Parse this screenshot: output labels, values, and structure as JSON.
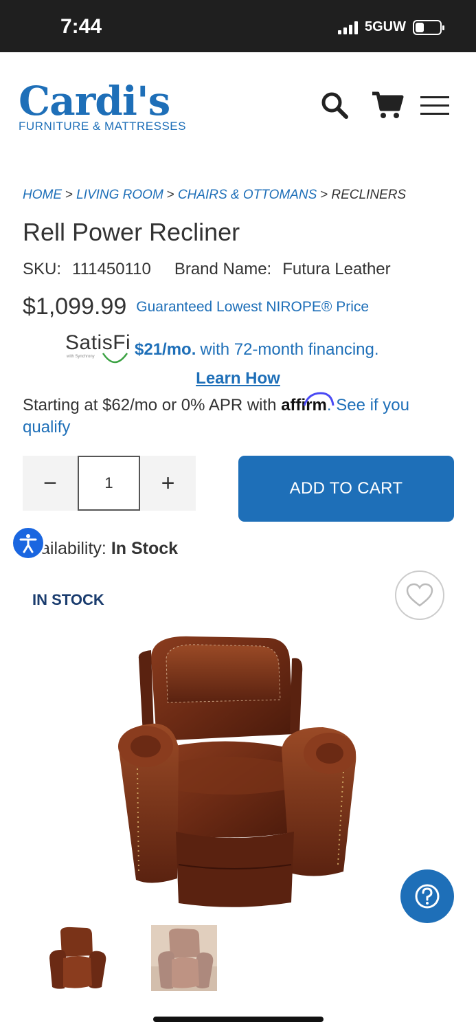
{
  "status_bar": {
    "time": "7:44",
    "network": "5GUW",
    "battery_level": 0.35,
    "icons": [
      "signal-icon",
      "battery-icon"
    ]
  },
  "header": {
    "logo_main": "Cardi's",
    "logo_sub": "FURNITURE & MATTRESSES",
    "icons": [
      "search-icon",
      "cart-icon",
      "menu-icon"
    ]
  },
  "breadcrumb": {
    "items": [
      "HOME",
      "LIVING ROOM",
      "CHAIRS & OTTOMANS",
      "RECLINERS"
    ],
    "separator": ">"
  },
  "product": {
    "title": "Rell Power Recliner",
    "sku_label": "SKU:",
    "sku": "111450110",
    "brand_label": "Brand Name:",
    "brand": "Futura Leather",
    "price": "$1,099.99",
    "price_note": "Guaranteed Lowest NIROPE® Price"
  },
  "financing": {
    "provider_logo": "SatisFi",
    "provider_sub": "with Synchrony",
    "monthly": "$21/mo.",
    "term_text": "with 72-month financing.",
    "learn_link": "Learn How",
    "affirm_prefix": "Starting at $62/mo or 0% APR with",
    "affirm_logo": "affirm",
    "affirm_link": ". See if you qualify"
  },
  "purchase": {
    "qty_minus": "−",
    "qty_value": "1",
    "qty_plus": "+",
    "add_to_cart": "ADD TO CART"
  },
  "availability": {
    "label": "ailability:",
    "value": "In Stock",
    "badge": "IN STOCK"
  },
  "gallery": {
    "main_image": "brown-leather-recliner",
    "thumbnails": [
      "recliner-front",
      "recliner-in-room"
    ]
  },
  "colors": {
    "brand_blue": "#1e6fb8",
    "accessibility_blue": "#1a66e0",
    "stock_navy": "#1a3c6e",
    "leather_brown": "#6b2a14"
  }
}
